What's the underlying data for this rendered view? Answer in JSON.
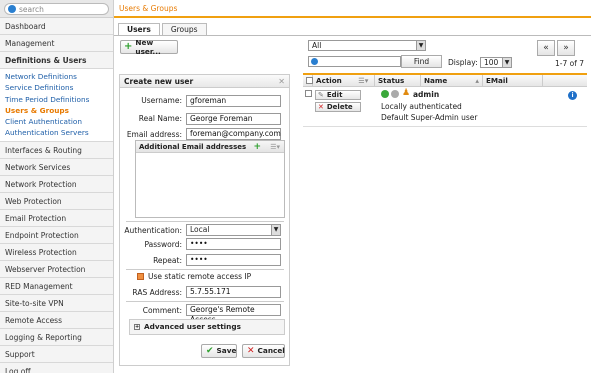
{
  "sidebar": {
    "search_placeholder": "search",
    "items_top": [
      "Dashboard",
      "Management"
    ],
    "group_label": "Definitions & Users",
    "sub_items": [
      "Network Definitions",
      "Service Definitions",
      "Time Period Definitions",
      "Users & Groups",
      "Client Authentication",
      "Authentication Servers"
    ],
    "active_sub": "Users & Groups",
    "items_bottom": [
      "Interfaces & Routing",
      "Network Services",
      "Network Protection",
      "Web Protection",
      "Email Protection",
      "Endpoint Protection",
      "Wireless Protection",
      "Webserver Protection",
      "RED Management",
      "Site-to-site VPN",
      "Remote Access",
      "Logging & Reporting",
      "Support",
      "Log off"
    ]
  },
  "breadcrumb": "Users & Groups",
  "tabs": [
    "Users",
    "Groups"
  ],
  "new_user_label": "New user...",
  "form": {
    "title": "Create new user",
    "username_label": "Username:",
    "username_value": "gforeman",
    "realname_label": "Real Name:",
    "realname_value": "George Foreman",
    "email_label": "Email address:",
    "email_value": "foreman@company.com",
    "additional_email_label": "Additional Email addresses",
    "auth_label": "Authentication:",
    "auth_value": "Local",
    "password_label": "Password:",
    "password_value": "••••",
    "repeat_label": "Repeat:",
    "repeat_value": "••••",
    "static_ip_label": "Use static remote access IP",
    "ras_label": "RAS Address:",
    "ras_value": "5.7.55.171",
    "comment_label": "Comment:",
    "comment_value": "George's Remote Access",
    "advanced_label": "Advanced user settings",
    "save_label": "Save",
    "cancel_label": "Cancel"
  },
  "list": {
    "filter_value": "All",
    "find_label": "Find",
    "display_label": "Display:",
    "display_value": "100",
    "count": "1-7 of 7",
    "prev": "«",
    "next": "»",
    "columns": [
      "Action",
      "Status",
      "Name",
      "EMail"
    ],
    "row": {
      "edit_label": "Edit",
      "delete_label": "Delete",
      "name": "admin",
      "line2": "Locally authenticated",
      "line3": "Default Super-Admin user"
    }
  }
}
